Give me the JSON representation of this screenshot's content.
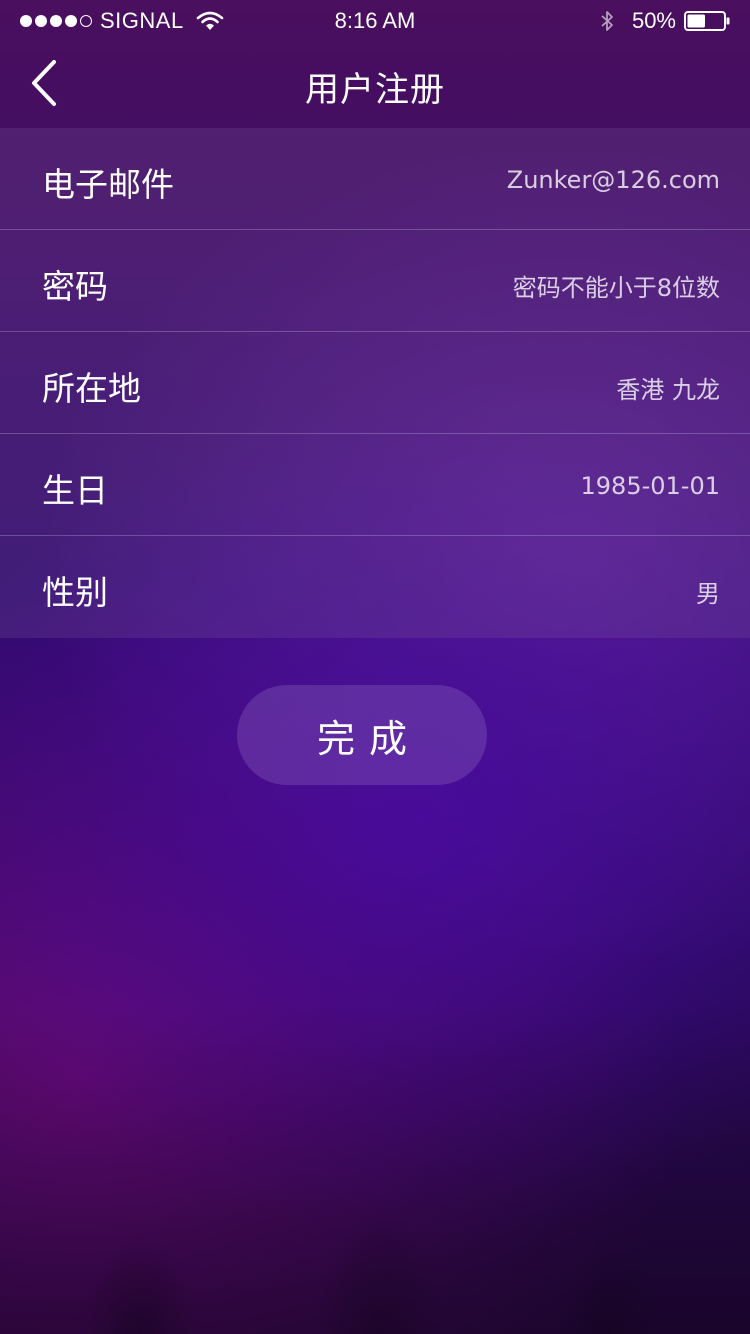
{
  "status_bar": {
    "carrier": "SIGNAL",
    "time": "8:16 AM",
    "battery": "50%",
    "battery_level": 0.5,
    "signal_bars_filled": 4,
    "signal_bars_total": 5,
    "icons": [
      "wifi-icon",
      "bluetooth-icon",
      "battery-icon"
    ]
  },
  "nav": {
    "title": "用户注册",
    "back_icon": "chevron-left-icon"
  },
  "form": {
    "rows": [
      {
        "label": "电子邮件",
        "value": "Zunker@126.com"
      },
      {
        "label": "密码",
        "value": "密码不能小于8位数"
      },
      {
        "label": "所在地",
        "value": "香港 九龙"
      },
      {
        "label": "生日",
        "value": "1985-01-01"
      },
      {
        "label": "性别",
        "value": "男"
      }
    ]
  },
  "done_button": {
    "label": "完成"
  },
  "colors": {
    "background_top": "#4a0f5e",
    "background_mid": "#2d0a6d",
    "background_bottom": "#1f0637",
    "text": "#ffffff"
  }
}
